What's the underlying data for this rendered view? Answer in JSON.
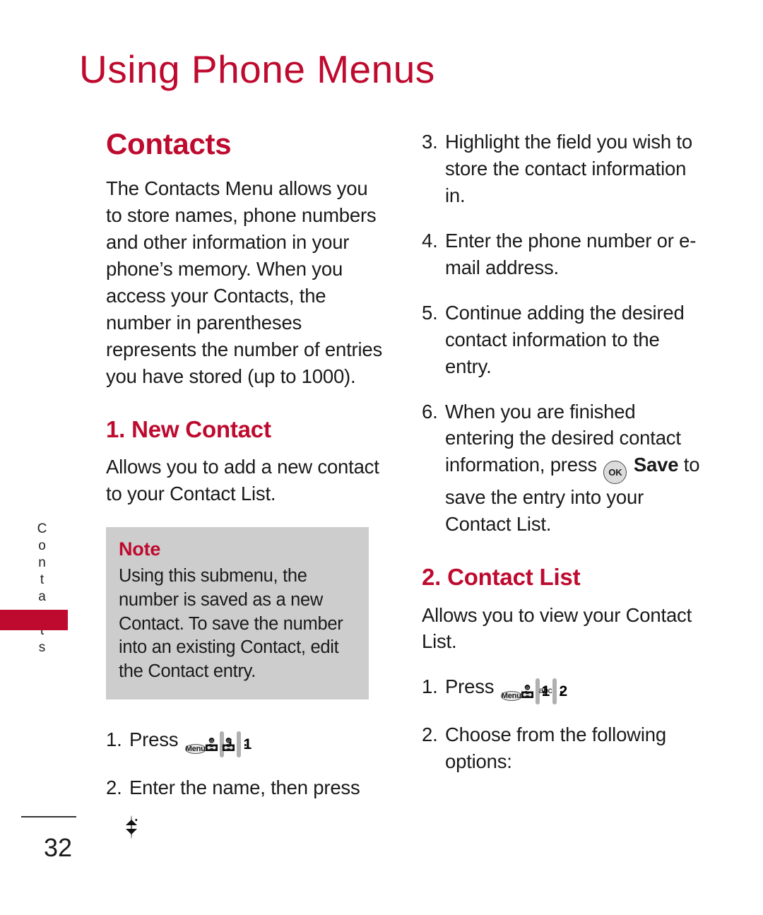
{
  "page": {
    "title": "Using Phone Menus",
    "number": "32",
    "side_tab": "Contacts",
    "accent_color": "#BE0A2E",
    "note_bg_color": "#cdcdcd"
  },
  "left_column": {
    "section_heading": "Contacts",
    "intro": "The Contacts Menu allows you to store names, phone numbers and other information in your phone’s memory. When you access your Contacts, the number in parentheses represents the number of entries you have stored (up to 1000).",
    "sub_heading": "1. New Contact",
    "sub_body": "Allows you to add a new contact to your Contact List.",
    "note": {
      "title": "Note",
      "text": "Using this submenu, the number is saved as a new Contact. To save the number into an existing Contact, edit the Contact entry."
    },
    "steps": [
      {
        "num": "1.",
        "pre": "Press",
        "keys": [
          "menu-key",
          "one-key",
          "one-key"
        ],
        "post": "."
      },
      {
        "num": "2.",
        "pre": "Enter the name, then press",
        "keys": [
          "navigation-key"
        ],
        "post": "."
      }
    ]
  },
  "right_column": {
    "steps": [
      {
        "num": "3.",
        "text": "Highlight the field you wish to store the contact information in."
      },
      {
        "num": "4.",
        "text": "Enter the phone number or e-mail address."
      },
      {
        "num": "5.",
        "text": "Continue adding the desired contact information to the entry."
      },
      {
        "num": "6.",
        "text_before": "When you are finished entering the desired contact information, press",
        "key": "ok-key",
        "bold_word": "Save",
        "text_after": "to save the entry into your Contact List."
      }
    ],
    "sub_heading": "2. Contact List",
    "sub_body": "Allows you to view your Contact List.",
    "steps2": [
      {
        "num": "1.",
        "pre": "Press",
        "keys": [
          "menu-key",
          "one-key",
          "two-key"
        ],
        "post": "."
      },
      {
        "num": "2.",
        "text": "Choose from the following options:"
      }
    ]
  },
  "keys": {
    "menu_label": "Menu",
    "ok_label": "OK",
    "one_digit": "1",
    "two_digit": "2",
    "two_letters": "abc"
  },
  "punctuation": {
    "comma": ",",
    "period": "."
  }
}
